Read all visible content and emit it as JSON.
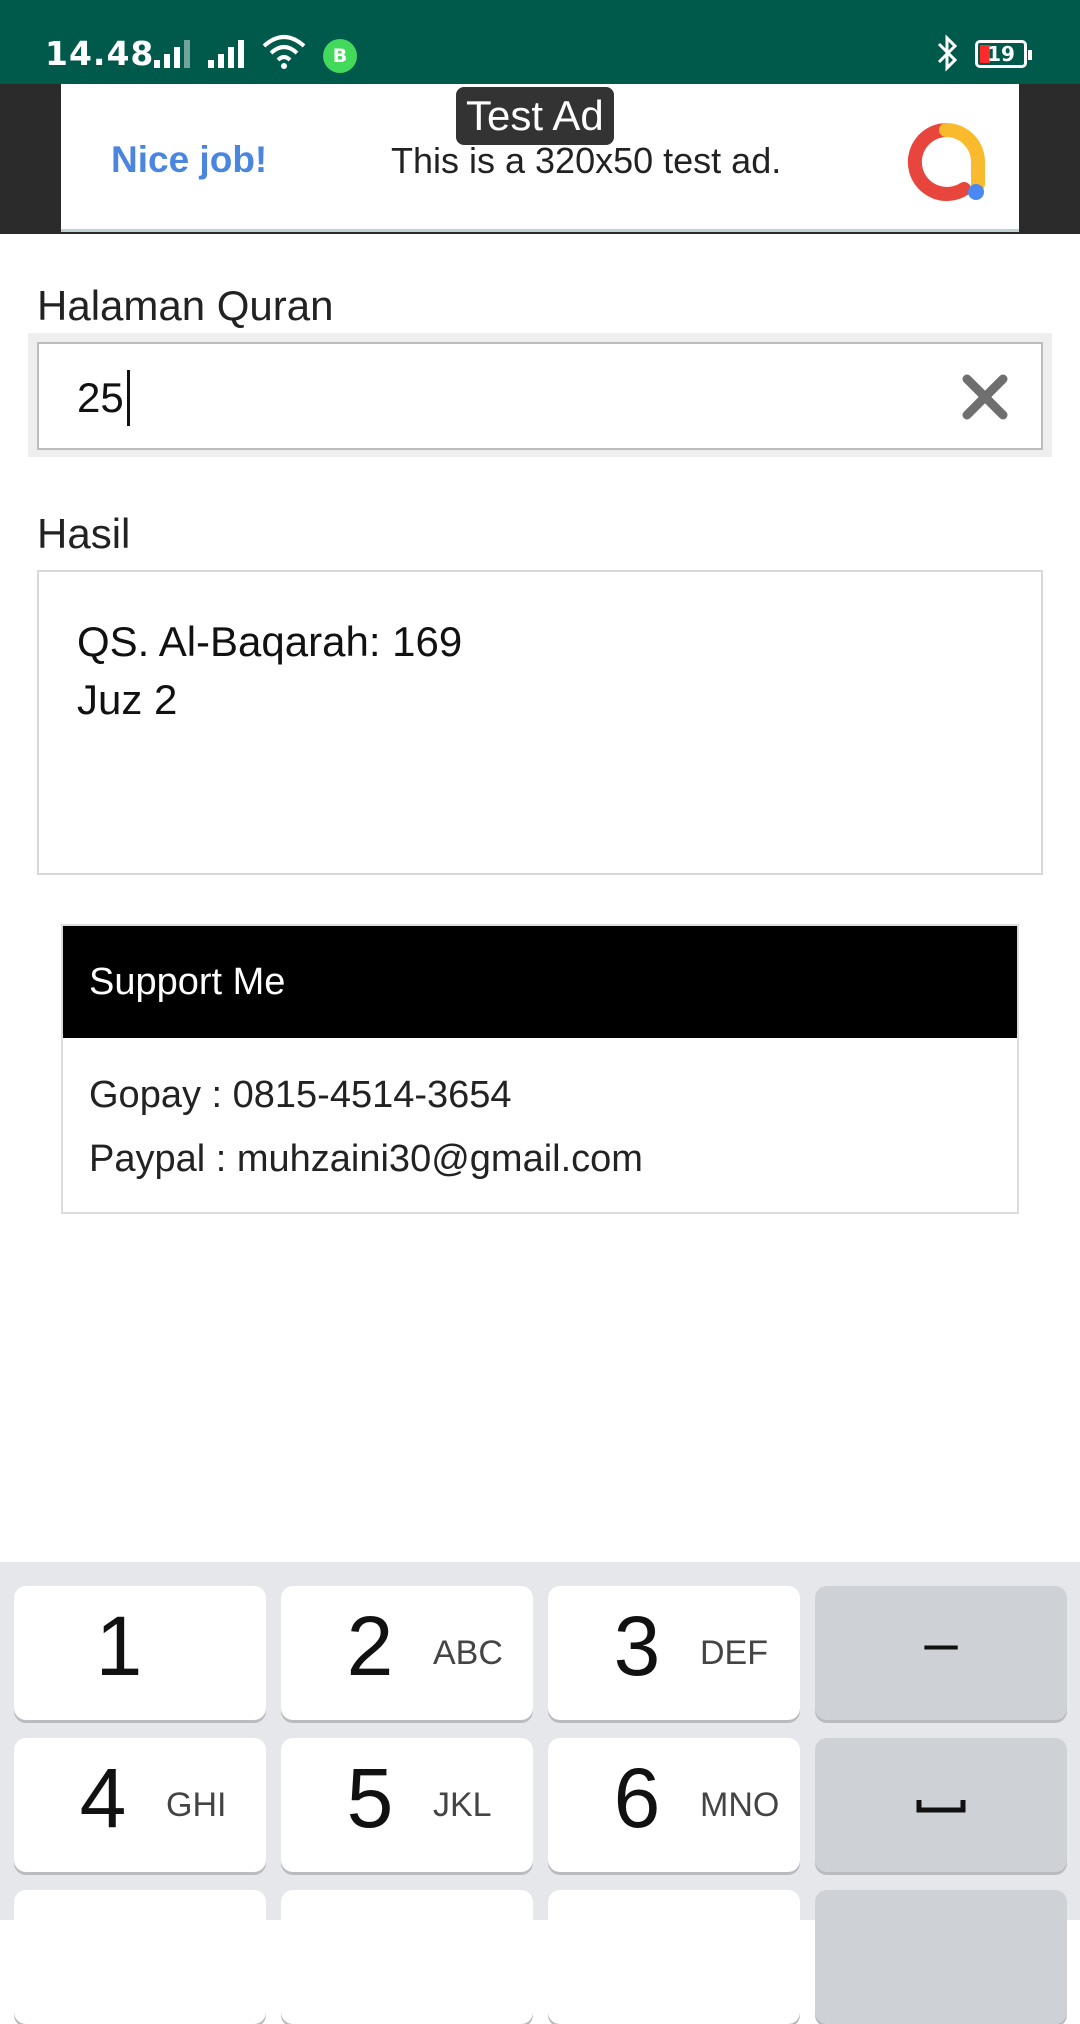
{
  "status_bar": {
    "time": "14.48",
    "battery": "19",
    "app_badge": "B"
  },
  "ad": {
    "badge": "Test Ad",
    "nice": "Nice job!",
    "text": "This is a 320x50 test ad."
  },
  "form": {
    "page_label": "Halaman Quran",
    "page_value": "25",
    "result_label": "Hasil",
    "result_lines": [
      "QS. Al-Baqarah: 169",
      "Juz 2"
    ]
  },
  "support": {
    "title": "Support Me",
    "gopay": "Gopay : 0815-4514-3654",
    "paypal": "Paypal : muhzaini30@gmail.com"
  },
  "keyboard": {
    "keys": [
      {
        "digit": "1",
        "letters": ""
      },
      {
        "digit": "2",
        "letters": "ABC"
      },
      {
        "digit": "3",
        "letters": "DEF"
      },
      {
        "digit": "4",
        "letters": "GHI"
      },
      {
        "digit": "5",
        "letters": "JKL"
      },
      {
        "digit": "6",
        "letters": "MNO"
      }
    ],
    "minus": "–"
  },
  "colors": {
    "status_bar": "#005a4c",
    "ad_accent": "#4a86e0"
  }
}
